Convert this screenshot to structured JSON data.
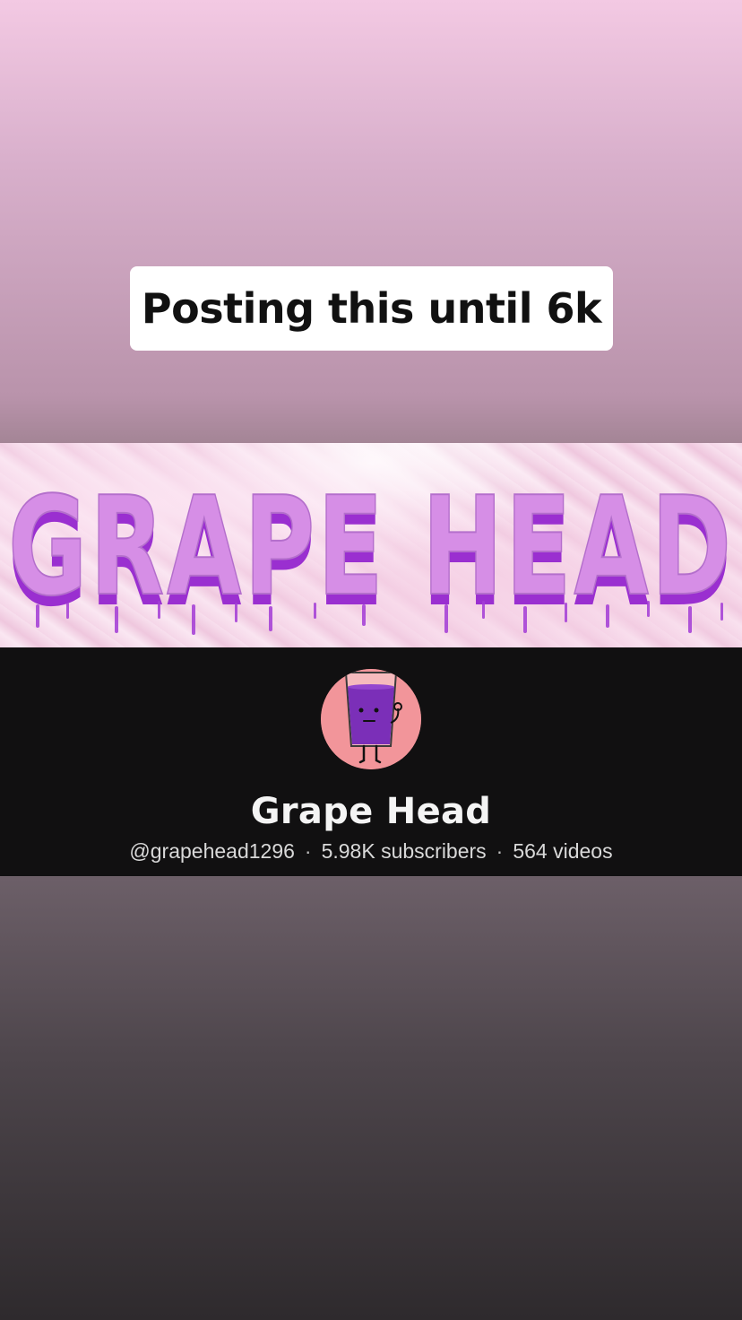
{
  "caption": {
    "text": "Posting this until 6k"
  },
  "banner": {
    "title": "GRAPE HEAD",
    "text_color": "#d68ee6",
    "drip_color": "#9a2fd0"
  },
  "channel": {
    "name": "Grape Head",
    "handle": "@grapehead1296",
    "subscribers": "5.98K subscribers",
    "videos": "564 videos",
    "separator": "·",
    "avatar_icon": "grape-juice-glass-character-icon",
    "avatar_bg": "#f2959a"
  }
}
